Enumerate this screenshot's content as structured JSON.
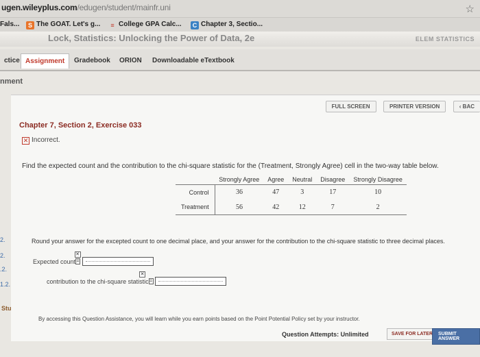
{
  "browser": {
    "url_host": "ugen.wileyplus.com",
    "url_path": "/edugen/student/mainfr.uni",
    "bookmarks": [
      {
        "label": "Fals...",
        "icon": "folder-icon"
      },
      {
        "label": "The GOAT. Let's g...",
        "icon": "orange-s-icon"
      },
      {
        "label": "College GPA Calc...",
        "icon": "calculator-icon"
      },
      {
        "label": "Chapter 3, Sectio...",
        "icon": "c-icon"
      }
    ]
  },
  "header": {
    "book_title": "Lock, Statistics: Unlocking the Power of Data, 2e",
    "right_label": "ELEM STATISTICS"
  },
  "tabs": [
    {
      "label": "ctice"
    },
    {
      "label": "Assignment"
    },
    {
      "label": "Gradebook"
    },
    {
      "label": "ORION"
    },
    {
      "label": "Downloadable eTextbook"
    }
  ],
  "section_label": "nment",
  "toolbar": {
    "full_screen": "FULL SCREEN",
    "printer_version": "PRINTER VERSION",
    "back": "‹ BAC"
  },
  "exercise": {
    "title": "Chapter 7, Section 2, Exercise 033",
    "status": "Incorrect.",
    "question": "Find the expected count and the contribution to the chi-square statistic for the (Treatment, Strongly Agree) cell in the two-way table below.",
    "table": {
      "headers": [
        "Strongly Agree",
        "Agree",
        "Neutral",
        "Disagree",
        "Strongly Disagree"
      ],
      "rows": [
        {
          "label": "Control",
          "values": [
            "36",
            "47",
            "3",
            "17",
            "10"
          ]
        },
        {
          "label": "Treatment",
          "values": [
            "56",
            "42",
            "12",
            "7",
            "2"
          ]
        }
      ]
    },
    "round_note": "Round your answer for the excepted count to one decimal place, and your answer for the contribution to the chi-square statistic to three decimal places.",
    "expected_label": "Expected count",
    "expected_value": "",
    "contribution_label": "contribution to the chi-square statistic",
    "contribution_value": ""
  },
  "assistance_note": "By accessing this Question Assistance, you will learn while you earn points based on the Point Potential Policy set by your instructor.",
  "footer": {
    "attempts_label": "Question Attempts: Unlimited",
    "save_later": "SAVE FOR LATER",
    "submit": "SUBMIT ANSWER"
  },
  "gutter": {
    "items": [
      "2.",
      "2.",
      ".2.",
      "1.2."
    ],
    "study": "Study"
  },
  "colors": {
    "accent": "#8b2b22",
    "submit": "#4a6fa5",
    "link": "#3a6aa8"
  }
}
